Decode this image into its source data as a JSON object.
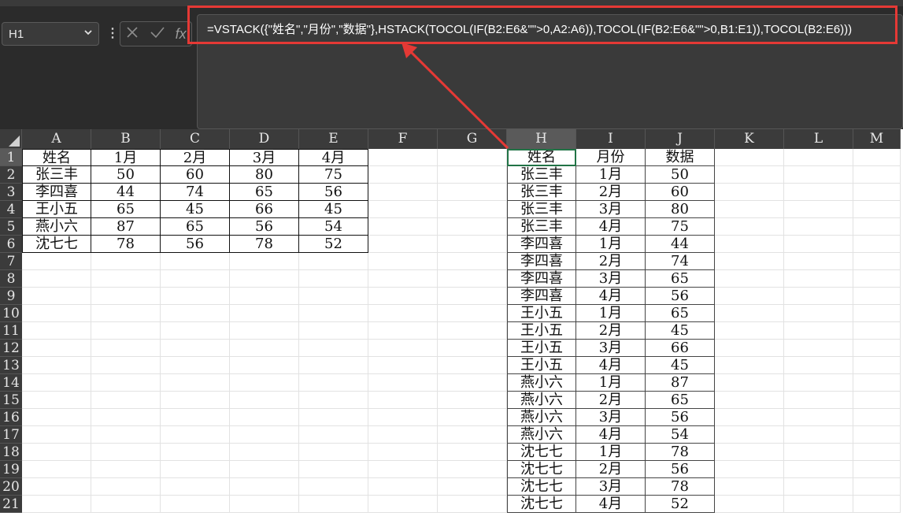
{
  "name_box": {
    "value": "H1"
  },
  "formula_bar": {
    "formula": "=VSTACK({\"姓名\",\"月份\",\"数据\"},HSTACK(TOCOL(IF(B2:E6&\"\">0,A2:A6)),TOCOL(IF(B2:E6&\"\">0,B1:E1)),TOCOL(B2:E6)))",
    "fx_label": "fx"
  },
  "columns": [
    "A",
    "B",
    "C",
    "D",
    "E",
    "F",
    "G",
    "H",
    "I",
    "J",
    "K",
    "L",
    "M"
  ],
  "rows": [
    "1",
    "2",
    "3",
    "4",
    "5",
    "6",
    "7",
    "8",
    "9",
    "10",
    "11",
    "12",
    "13",
    "14",
    "15",
    "16",
    "17",
    "18",
    "19",
    "20",
    "21"
  ],
  "source_table": {
    "header": [
      "姓名",
      "1月",
      "2月",
      "3月",
      "4月"
    ],
    "rows": [
      [
        "张三丰",
        "50",
        "60",
        "80",
        "75"
      ],
      [
        "李四喜",
        "44",
        "74",
        "65",
        "56"
      ],
      [
        "王小五",
        "65",
        "45",
        "66",
        "45"
      ],
      [
        "燕小六",
        "87",
        "65",
        "56",
        "54"
      ],
      [
        "沈七七",
        "78",
        "56",
        "78",
        "52"
      ]
    ]
  },
  "result_table": {
    "header": [
      "姓名",
      "月份",
      "数据"
    ],
    "rows": [
      [
        "张三丰",
        "1月",
        "50"
      ],
      [
        "张三丰",
        "2月",
        "60"
      ],
      [
        "张三丰",
        "3月",
        "80"
      ],
      [
        "张三丰",
        "4月",
        "75"
      ],
      [
        "李四喜",
        "1月",
        "44"
      ],
      [
        "李四喜",
        "2月",
        "74"
      ],
      [
        "李四喜",
        "3月",
        "65"
      ],
      [
        "李四喜",
        "4月",
        "56"
      ],
      [
        "王小五",
        "1月",
        "65"
      ],
      [
        "王小五",
        "2月",
        "45"
      ],
      [
        "王小五",
        "3月",
        "66"
      ],
      [
        "王小五",
        "4月",
        "45"
      ],
      [
        "燕小六",
        "1月",
        "87"
      ],
      [
        "燕小六",
        "2月",
        "65"
      ],
      [
        "燕小六",
        "3月",
        "56"
      ],
      [
        "燕小六",
        "4月",
        "54"
      ],
      [
        "沈七七",
        "1月",
        "78"
      ],
      [
        "沈七七",
        "2月",
        "56"
      ],
      [
        "沈七七",
        "3月",
        "78"
      ],
      [
        "沈七七",
        "4月",
        "52"
      ]
    ]
  },
  "colors": {
    "highlight": "#e53935",
    "selection": "#217346",
    "header_bg": "#3b3b3b"
  },
  "icons": {
    "dropdown": "chevron-down-icon",
    "cancel": "cancel-icon",
    "confirm": "check-icon",
    "function": "fx-icon",
    "select_all": "select-all-icon",
    "annotation": "arrow-icon"
  }
}
